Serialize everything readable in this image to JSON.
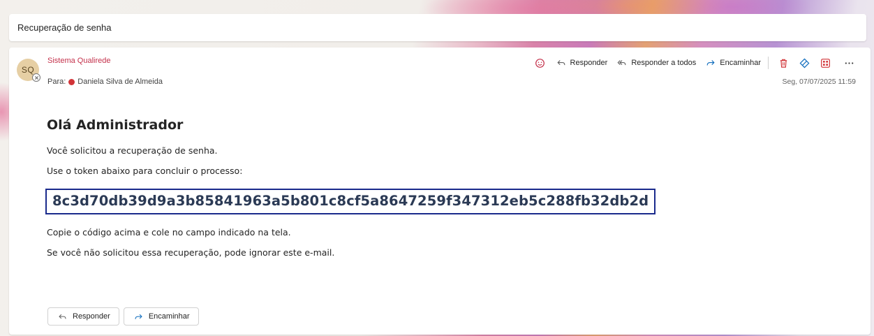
{
  "subject": "Recuperação de senha",
  "sender": {
    "initials": "SQ",
    "name": "Sistema Qualirede"
  },
  "recipient": {
    "prefix": "Para:",
    "name": "Daniela Silva de Almeida"
  },
  "datetime": "Seg, 07/07/2025 11:59",
  "actions": {
    "reply": "Responder",
    "reply_all": "Responder a todos",
    "forward": "Encaminhar"
  },
  "icons": {
    "emoji": "emoji-icon",
    "reply": "reply-arrow-icon",
    "reply_all": "reply-all-arrow-icon",
    "forward": "forward-arrow-icon",
    "delete": "trash-icon",
    "tag": "tag-icon",
    "apps": "apps-grid-icon",
    "more": "more-icon"
  },
  "colors": {
    "accent": "#0f6cbd",
    "sender_name": "#c4314b",
    "danger": "#d13438",
    "token_border": "#1a2a8c",
    "token_text": "#2b3a55"
  },
  "body": {
    "greeting": "Olá Administrador",
    "line1": "Você solicitou a recuperação de senha.",
    "line2": "Use o token abaixo para concluir o processo:",
    "token": "8c3d70db39d9a3b85841963a5b801c8cf5a8647259f347312eb5c288fb32db2d",
    "line3": "Copie o código acima e cole no campo indicado na tela.",
    "line4": "Se você não solicitou essa recuperação, pode ignorar este e-mail."
  },
  "footer": {
    "reply": "Responder",
    "forward": "Encaminhar"
  }
}
